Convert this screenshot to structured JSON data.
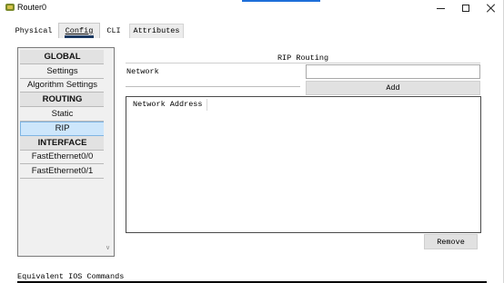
{
  "window": {
    "title": "Router0",
    "icon": "router-icon",
    "controls": {
      "minimize": "minimize-icon",
      "maximize": "maximize-icon",
      "close": "close-icon"
    }
  },
  "tabs": [
    {
      "label": "Physical",
      "active": false
    },
    {
      "label": "Config",
      "active": true
    },
    {
      "label": "CLI",
      "active": false
    },
    {
      "label": "Attributes",
      "active": false
    }
  ],
  "nav": {
    "items": [
      {
        "label": "GLOBAL",
        "header": true
      },
      {
        "label": "Settings",
        "header": false
      },
      {
        "label": "Algorithm Settings",
        "header": false
      },
      {
        "label": "ROUTING",
        "header": true
      },
      {
        "label": "Static",
        "header": false
      },
      {
        "label": "RIP",
        "header": false,
        "selected": true
      },
      {
        "label": "INTERFACE",
        "header": true
      },
      {
        "label": "FastEthernet0/0",
        "header": false
      },
      {
        "label": "FastEthernet0/1",
        "header": false
      }
    ]
  },
  "rip": {
    "title": "RIP Routing",
    "network_label": "Network",
    "network_value": "",
    "add_label": "Add",
    "table_header": "Network Address",
    "remove_label": "Remove"
  },
  "footer": {
    "equivalent_label": "Equivalent IOS Commands"
  },
  "colors": {
    "accent": "#1e6fd9",
    "tab_underline": "#1c3a63",
    "selected_item": "#cde6fb"
  }
}
